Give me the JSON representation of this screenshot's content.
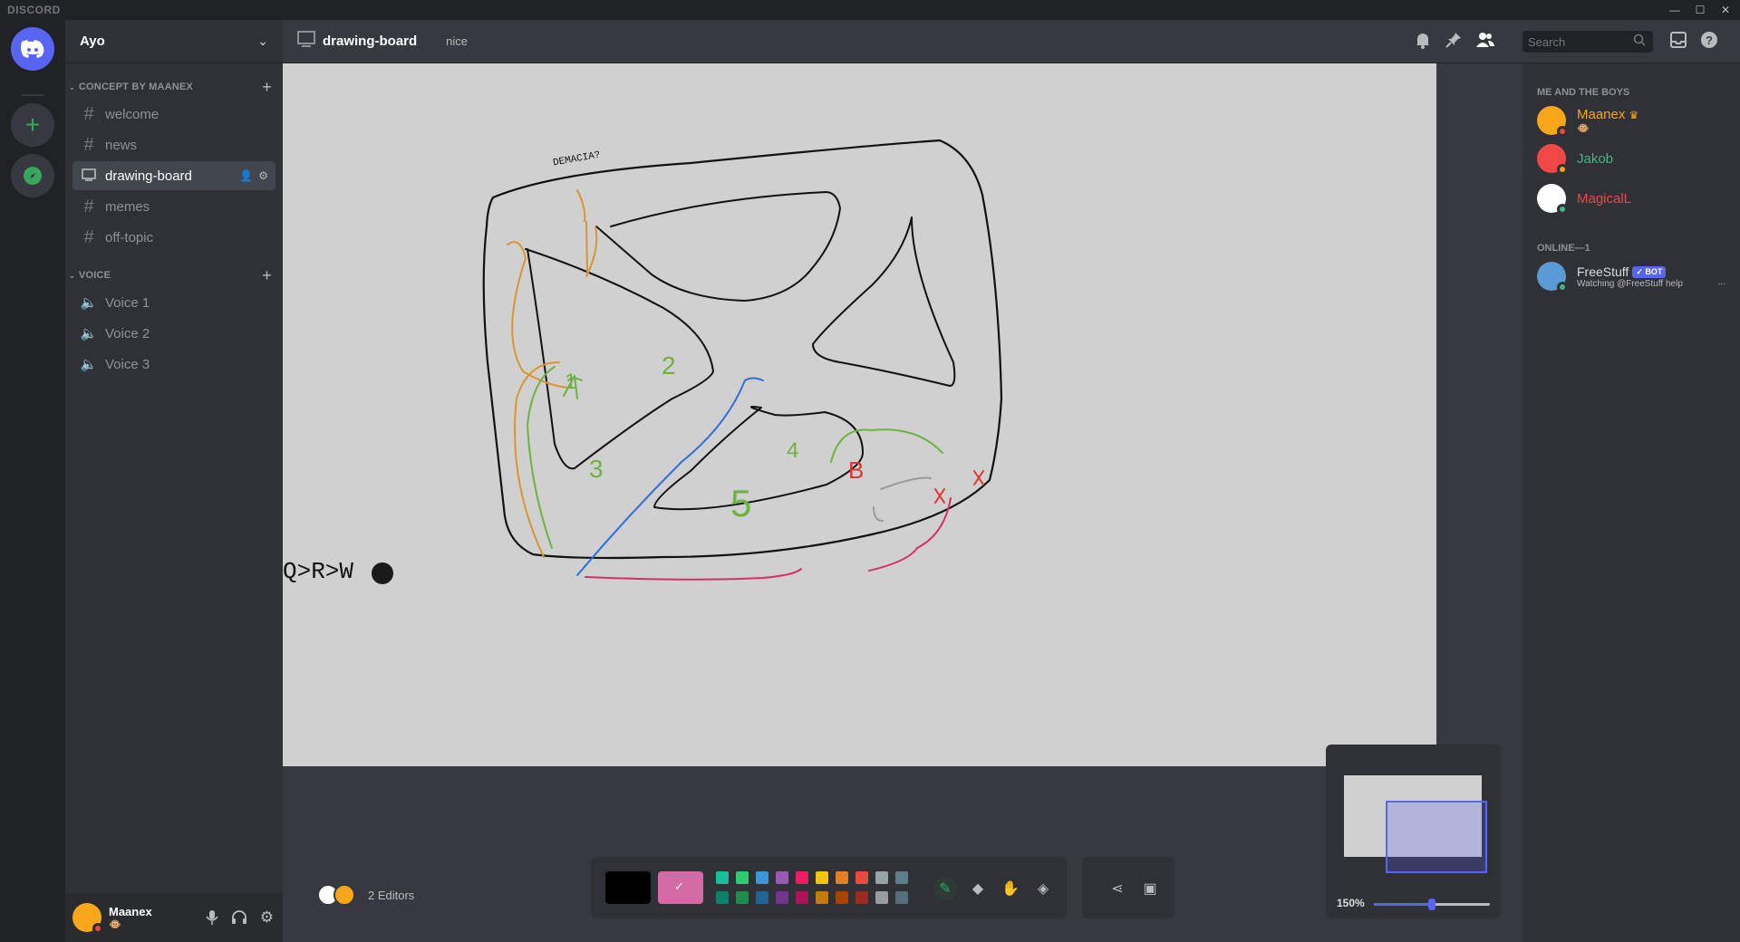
{
  "app": {
    "brand": "DISCORD"
  },
  "server": {
    "name": "Ayo",
    "categories": [
      {
        "name": "CONCEPT BY MAANEX",
        "channels": [
          "welcome",
          "news",
          "drawing-board",
          "memes",
          "off-topic"
        ]
      },
      {
        "name": "VOICE",
        "channels": [
          "Voice 1",
          "Voice 2",
          "Voice 3"
        ]
      }
    ],
    "active_channel": "drawing-board"
  },
  "header": {
    "channel": "drawing-board",
    "topic": "nice",
    "search_placeholder": "Search"
  },
  "user": {
    "name": "Maanex",
    "status_emoji": "🐵"
  },
  "members": {
    "group1_title": "ME AND THE BOYS",
    "group1": [
      {
        "name": "Maanex",
        "color": "#faa61a",
        "sub": "🐵",
        "crown": "♛"
      },
      {
        "name": "Jakob",
        "color": "#43b581"
      },
      {
        "name": "MagicalL",
        "color": "#f04747"
      }
    ],
    "group2_title": "ONLINE—1",
    "group2": [
      {
        "name": "FreeStuff",
        "color": "#dcddde",
        "badge": "✓ BOT",
        "sub": "Watching @FreeStuff help",
        "more": "..."
      }
    ]
  },
  "canvas": {
    "text_top": "DEMACIA?",
    "text_left": "Q>R>W",
    "numbers": [
      "1",
      "2",
      "3",
      "4",
      "5"
    ],
    "letter_b": "B"
  },
  "toolbar": {
    "editors_label": "2 Editors",
    "main_color": "#000000",
    "second_color": "#d46aa5",
    "palette_top": [
      "#1abc9c",
      "#2ecc71",
      "#3498db",
      "#9b59b6",
      "#e91e63",
      "#f1c40f",
      "#e67e22",
      "#e74c3c",
      "#95a5a6",
      "#607d8b"
    ],
    "palette_bottom": [
      "#11806a",
      "#1f8b4c",
      "#206694",
      "#71368a",
      "#ad1457",
      "#c27c0e",
      "#a84300",
      "#992d22",
      "#979c9f",
      "#546e7a"
    ]
  },
  "minimap": {
    "zoom_label": "150%",
    "zoom_fraction": 0.5
  }
}
